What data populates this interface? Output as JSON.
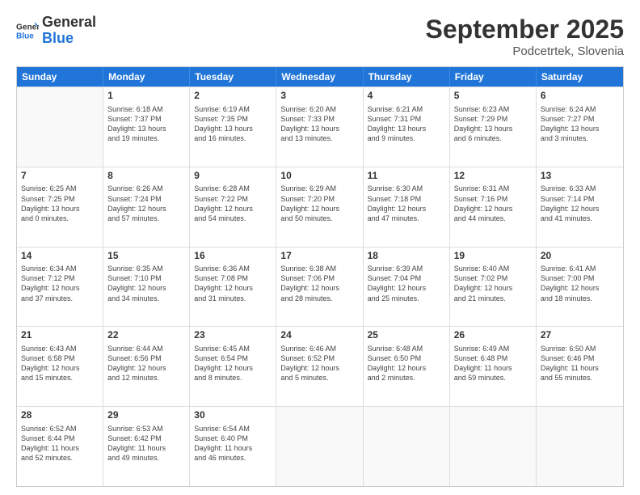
{
  "logo": {
    "general": "General",
    "blue": "Blue"
  },
  "title": "September 2025",
  "subtitle": "Podcetrtek, Slovenia",
  "header_days": [
    "Sunday",
    "Monday",
    "Tuesday",
    "Wednesday",
    "Thursday",
    "Friday",
    "Saturday"
  ],
  "weeks": [
    [
      {
        "day": "",
        "lines": []
      },
      {
        "day": "1",
        "lines": [
          "Sunrise: 6:18 AM",
          "Sunset: 7:37 PM",
          "Daylight: 13 hours",
          "and 19 minutes."
        ]
      },
      {
        "day": "2",
        "lines": [
          "Sunrise: 6:19 AM",
          "Sunset: 7:35 PM",
          "Daylight: 13 hours",
          "and 16 minutes."
        ]
      },
      {
        "day": "3",
        "lines": [
          "Sunrise: 6:20 AM",
          "Sunset: 7:33 PM",
          "Daylight: 13 hours",
          "and 13 minutes."
        ]
      },
      {
        "day": "4",
        "lines": [
          "Sunrise: 6:21 AM",
          "Sunset: 7:31 PM",
          "Daylight: 13 hours",
          "and 9 minutes."
        ]
      },
      {
        "day": "5",
        "lines": [
          "Sunrise: 6:23 AM",
          "Sunset: 7:29 PM",
          "Daylight: 13 hours",
          "and 6 minutes."
        ]
      },
      {
        "day": "6",
        "lines": [
          "Sunrise: 6:24 AM",
          "Sunset: 7:27 PM",
          "Daylight: 13 hours",
          "and 3 minutes."
        ]
      }
    ],
    [
      {
        "day": "7",
        "lines": [
          "Sunrise: 6:25 AM",
          "Sunset: 7:25 PM",
          "Daylight: 13 hours",
          "and 0 minutes."
        ]
      },
      {
        "day": "8",
        "lines": [
          "Sunrise: 6:26 AM",
          "Sunset: 7:24 PM",
          "Daylight: 12 hours",
          "and 57 minutes."
        ]
      },
      {
        "day": "9",
        "lines": [
          "Sunrise: 6:28 AM",
          "Sunset: 7:22 PM",
          "Daylight: 12 hours",
          "and 54 minutes."
        ]
      },
      {
        "day": "10",
        "lines": [
          "Sunrise: 6:29 AM",
          "Sunset: 7:20 PM",
          "Daylight: 12 hours",
          "and 50 minutes."
        ]
      },
      {
        "day": "11",
        "lines": [
          "Sunrise: 6:30 AM",
          "Sunset: 7:18 PM",
          "Daylight: 12 hours",
          "and 47 minutes."
        ]
      },
      {
        "day": "12",
        "lines": [
          "Sunrise: 6:31 AM",
          "Sunset: 7:16 PM",
          "Daylight: 12 hours",
          "and 44 minutes."
        ]
      },
      {
        "day": "13",
        "lines": [
          "Sunrise: 6:33 AM",
          "Sunset: 7:14 PM",
          "Daylight: 12 hours",
          "and 41 minutes."
        ]
      }
    ],
    [
      {
        "day": "14",
        "lines": [
          "Sunrise: 6:34 AM",
          "Sunset: 7:12 PM",
          "Daylight: 12 hours",
          "and 37 minutes."
        ]
      },
      {
        "day": "15",
        "lines": [
          "Sunrise: 6:35 AM",
          "Sunset: 7:10 PM",
          "Daylight: 12 hours",
          "and 34 minutes."
        ]
      },
      {
        "day": "16",
        "lines": [
          "Sunrise: 6:36 AM",
          "Sunset: 7:08 PM",
          "Daylight: 12 hours",
          "and 31 minutes."
        ]
      },
      {
        "day": "17",
        "lines": [
          "Sunrise: 6:38 AM",
          "Sunset: 7:06 PM",
          "Daylight: 12 hours",
          "and 28 minutes."
        ]
      },
      {
        "day": "18",
        "lines": [
          "Sunrise: 6:39 AM",
          "Sunset: 7:04 PM",
          "Daylight: 12 hours",
          "and 25 minutes."
        ]
      },
      {
        "day": "19",
        "lines": [
          "Sunrise: 6:40 AM",
          "Sunset: 7:02 PM",
          "Daylight: 12 hours",
          "and 21 minutes."
        ]
      },
      {
        "day": "20",
        "lines": [
          "Sunrise: 6:41 AM",
          "Sunset: 7:00 PM",
          "Daylight: 12 hours",
          "and 18 minutes."
        ]
      }
    ],
    [
      {
        "day": "21",
        "lines": [
          "Sunrise: 6:43 AM",
          "Sunset: 6:58 PM",
          "Daylight: 12 hours",
          "and 15 minutes."
        ]
      },
      {
        "day": "22",
        "lines": [
          "Sunrise: 6:44 AM",
          "Sunset: 6:56 PM",
          "Daylight: 12 hours",
          "and 12 minutes."
        ]
      },
      {
        "day": "23",
        "lines": [
          "Sunrise: 6:45 AM",
          "Sunset: 6:54 PM",
          "Daylight: 12 hours",
          "and 8 minutes."
        ]
      },
      {
        "day": "24",
        "lines": [
          "Sunrise: 6:46 AM",
          "Sunset: 6:52 PM",
          "Daylight: 12 hours",
          "and 5 minutes."
        ]
      },
      {
        "day": "25",
        "lines": [
          "Sunrise: 6:48 AM",
          "Sunset: 6:50 PM",
          "Daylight: 12 hours",
          "and 2 minutes."
        ]
      },
      {
        "day": "26",
        "lines": [
          "Sunrise: 6:49 AM",
          "Sunset: 6:48 PM",
          "Daylight: 11 hours",
          "and 59 minutes."
        ]
      },
      {
        "day": "27",
        "lines": [
          "Sunrise: 6:50 AM",
          "Sunset: 6:46 PM",
          "Daylight: 11 hours",
          "and 55 minutes."
        ]
      }
    ],
    [
      {
        "day": "28",
        "lines": [
          "Sunrise: 6:52 AM",
          "Sunset: 6:44 PM",
          "Daylight: 11 hours",
          "and 52 minutes."
        ]
      },
      {
        "day": "29",
        "lines": [
          "Sunrise: 6:53 AM",
          "Sunset: 6:42 PM",
          "Daylight: 11 hours",
          "and 49 minutes."
        ]
      },
      {
        "day": "30",
        "lines": [
          "Sunrise: 6:54 AM",
          "Sunset: 6:40 PM",
          "Daylight: 11 hours",
          "and 46 minutes."
        ]
      },
      {
        "day": "",
        "lines": []
      },
      {
        "day": "",
        "lines": []
      },
      {
        "day": "",
        "lines": []
      },
      {
        "day": "",
        "lines": []
      }
    ]
  ]
}
